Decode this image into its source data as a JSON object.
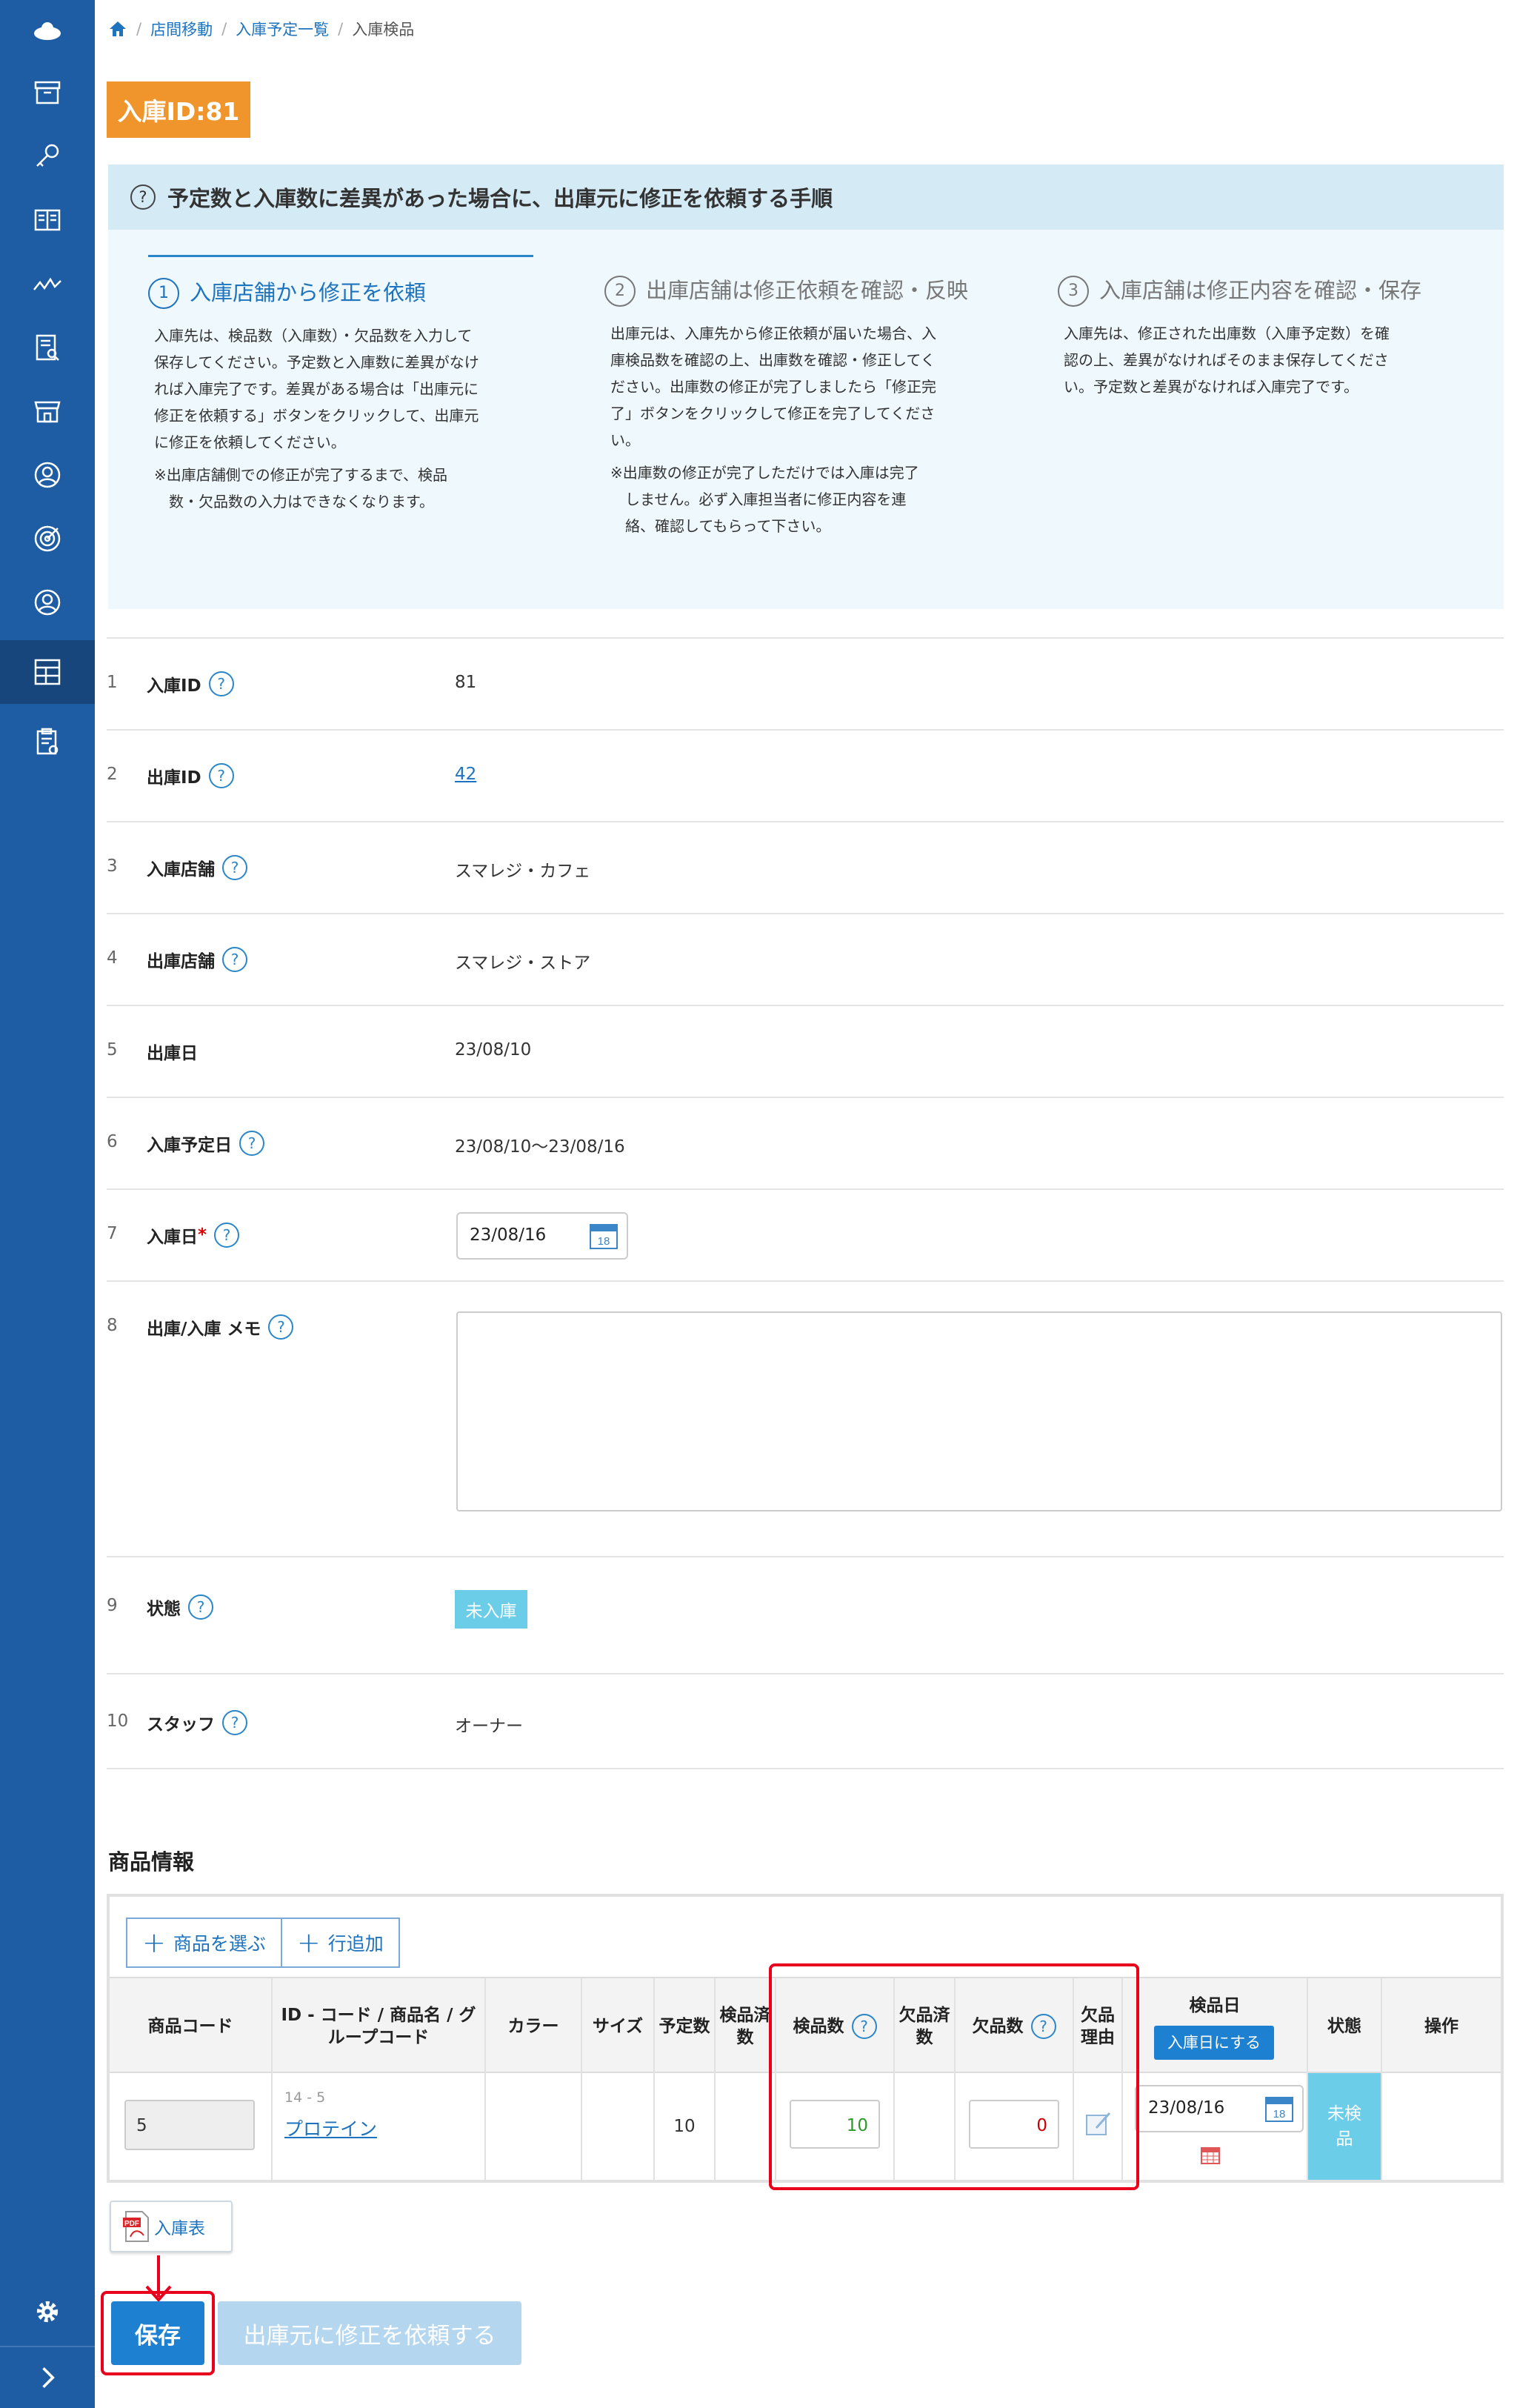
{
  "breadcrumb": {
    "home_icon": "home-icon",
    "items": [
      "店間移動",
      "入庫予定一覧",
      "入庫検品"
    ]
  },
  "page": {
    "id_badge": "入庫ID:81"
  },
  "guide": {
    "title": "予定数と入庫数に差異があった場合に、出庫元に修正を依頼する手順",
    "steps": [
      {
        "num": "1",
        "title": "入庫店舗から修正を依頼",
        "body": [
          "入庫先は、検品数（入庫数）・欠品数を入力して",
          "保存してください。予定数と入庫数に差異がなけ",
          "れば入庫完了です。差異がある場合は「出庫元に",
          "修正を依頼する」ボタンをクリックして、出庫元",
          "に修正を依頼してください。"
        ],
        "note": [
          "※出庫店舗側での修正が完了するまで、検品",
          "　数・欠品数の入力はできなくなります。"
        ]
      },
      {
        "num": "2",
        "title": "出庫店舗は修正依頼を確認・反映",
        "body": [
          "出庫元は、入庫先から修正依頼が届いた場合、入",
          "庫検品数を確認の上、出庫数を確認・修正してく",
          "ださい。出庫数の修正が完了しましたら「修正完",
          "了」ボタンをクリックして修正を完了してくださ",
          "い。"
        ],
        "note": [
          "※出庫数の修正が完了しただけでは入庫は完了",
          "　しません。必ず入庫担当者に修正内容を連",
          "　絡、確認してもらって下さい。"
        ]
      },
      {
        "num": "3",
        "title": "入庫店舗は修正内容を確認・保存",
        "body": [
          "入庫先は、修正された出庫数（入庫予定数）を確",
          "認の上、差異がなければそのまま保存してくださ",
          "い。予定数と差異がなければ入庫完了です。"
        ],
        "note": []
      }
    ]
  },
  "form": {
    "rows": [
      {
        "idx": "1",
        "label": "入庫ID",
        "value": "81"
      },
      {
        "idx": "2",
        "label": "出庫ID",
        "value": "42"
      },
      {
        "idx": "3",
        "label": "入庫店舗",
        "value": "スマレジ・カフェ"
      },
      {
        "idx": "4",
        "label": "出庫店舗",
        "value": "スマレジ・ストア"
      },
      {
        "idx": "5",
        "label": "出庫日",
        "value": "23/08/10"
      },
      {
        "idx": "6",
        "label": "入庫予定日",
        "value": "23/08/10〜23/08/16"
      },
      {
        "idx": "7",
        "label": "入庫日",
        "value": "23/08/16",
        "required": "*"
      },
      {
        "idx": "8",
        "label": "出庫/入庫 メモ",
        "value": ""
      },
      {
        "idx": "9",
        "label": "状態",
        "value": "未入庫"
      },
      {
        "idx": "10",
        "label": "スタッフ",
        "value": "オーナー"
      }
    ]
  },
  "products": {
    "section_title": "商品情報",
    "toolbar": {
      "select_label": "商品を選ぶ",
      "add_row_label": "行追加"
    },
    "headers": {
      "code": "商品コード",
      "name": [
        "ID - コード / 商品名 / グ",
        "ループコード"
      ],
      "color": "カラー",
      "size": "サイズ",
      "planned": "予定数",
      "inspected_done": [
        "検品済",
        "数"
      ],
      "inspected": "検品数",
      "shortage_done": [
        "欠品済",
        "数"
      ],
      "shortage": "欠品数",
      "reason": [
        "欠品",
        "理由"
      ],
      "inspect_date": "検品日",
      "to_today": "入庫日にする",
      "state": "状態",
      "ops": "操作"
    },
    "rows": [
      {
        "code": "5",
        "id_code": "14 - 5",
        "name": "プロテイン",
        "planned": "10",
        "inspected": "10",
        "shortage": "0",
        "inspect_date": "23/08/16",
        "state": [
          "未検",
          "品"
        ]
      }
    ]
  },
  "actions": {
    "print_label": "入庫表",
    "save_label": "保存",
    "request_fix_label": "出庫元に修正を依頼する"
  },
  "colors": {
    "sidebar": "#1e5da3",
    "accent": "#f0952c",
    "primary": "#1d80d1",
    "highlight": "#e8001c",
    "status": "#6ccde9"
  }
}
